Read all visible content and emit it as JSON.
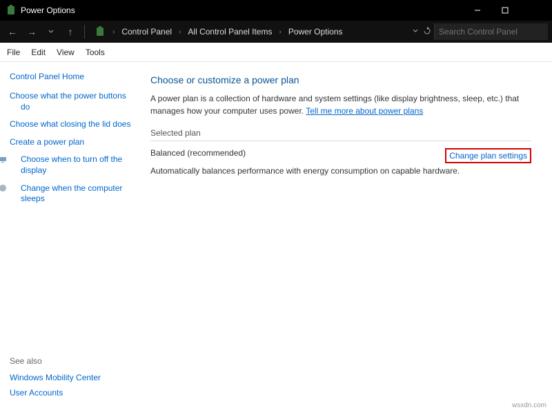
{
  "titlebar": {
    "title": "Power Options"
  },
  "breadcrumb": {
    "b1": "Control Panel",
    "b2": "All Control Panel Items",
    "b3": "Power Options"
  },
  "search": {
    "placeholder": "Search Control Panel"
  },
  "menu": {
    "file": "File",
    "edit": "Edit",
    "view": "View",
    "tools": "Tools"
  },
  "sidebar": {
    "home": "Control Panel Home",
    "items": [
      "Choose what the power buttons do",
      "Choose what closing the lid does",
      "Create a power plan",
      "Choose when to turn off the display",
      "Change when the computer sleeps"
    ],
    "seealso_hdr": "See also",
    "seealso": [
      "Windows Mobility Center",
      "User Accounts"
    ]
  },
  "main": {
    "heading": "Choose or customize a power plan",
    "desc_a": "A power plan is a collection of hardware and system settings (like display brightness, sleep, etc.) that manages how your computer uses power. ",
    "desc_link": "Tell me more about power plans",
    "selected_hdr": "Selected plan",
    "plan_name": "Balanced (recommended)",
    "change_link": "Change plan settings",
    "plan_desc": "Automatically balances performance with energy consumption on capable hardware."
  },
  "watermark": "wsxdn.com"
}
